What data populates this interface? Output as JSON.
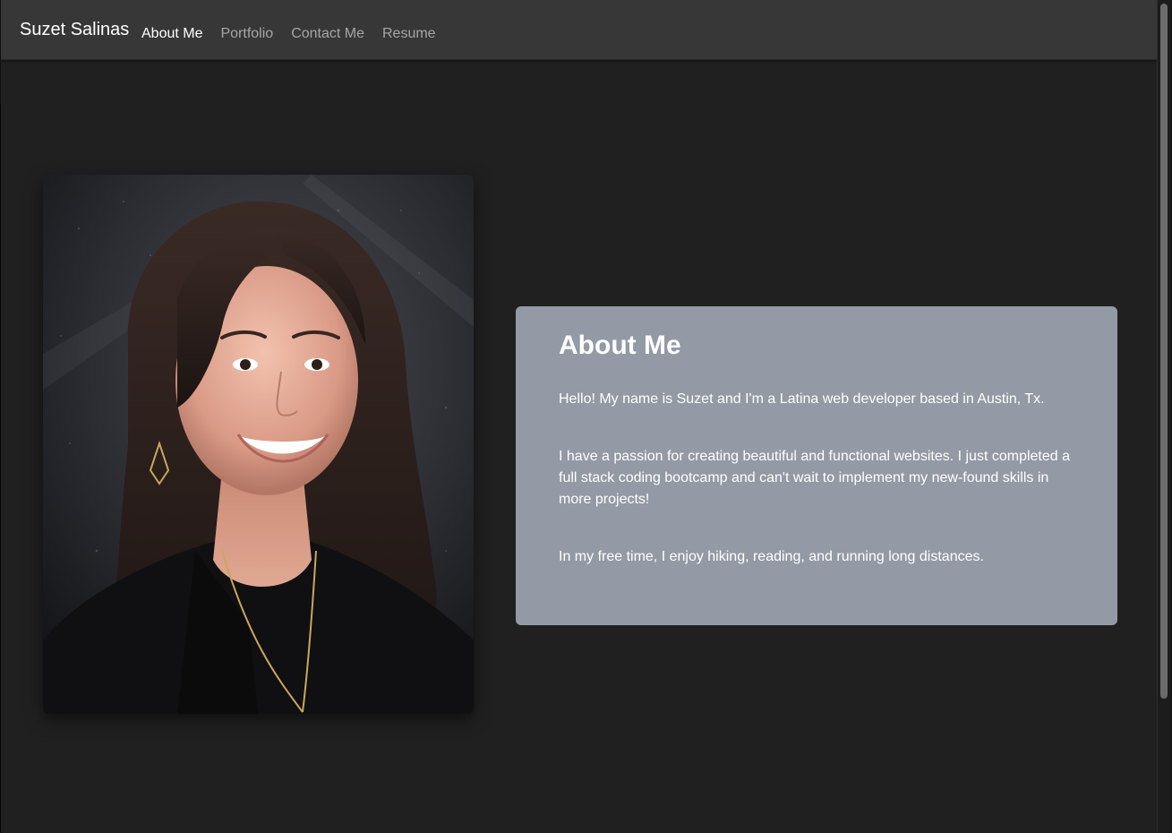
{
  "navbar": {
    "brand": "Suzet Salinas",
    "links": [
      {
        "label": "About Me",
        "active": true
      },
      {
        "label": "Portfolio",
        "active": false
      },
      {
        "label": "Contact Me",
        "active": false
      },
      {
        "label": "Resume",
        "active": false
      }
    ]
  },
  "about": {
    "title": "About Me",
    "paragraphs": [
      "Hello! My name is Suzet and I'm a Latina web developer based in Austin, Tx.",
      "I have a passion for creating beautiful and functional websites. I just completed a full stack coding bootcamp and can't wait to implement my new-found skills in more projects!",
      "In my free time, I enjoy hiking, reading, and running long distances."
    ]
  },
  "colors": {
    "page_background": "#202020",
    "navbar_background": "#373737",
    "card_background": "#939aa6",
    "text": "#ffffff",
    "nav_inactive": "#a6a6a6"
  },
  "icons": {
    "profile_photo": "portrait-photo"
  }
}
